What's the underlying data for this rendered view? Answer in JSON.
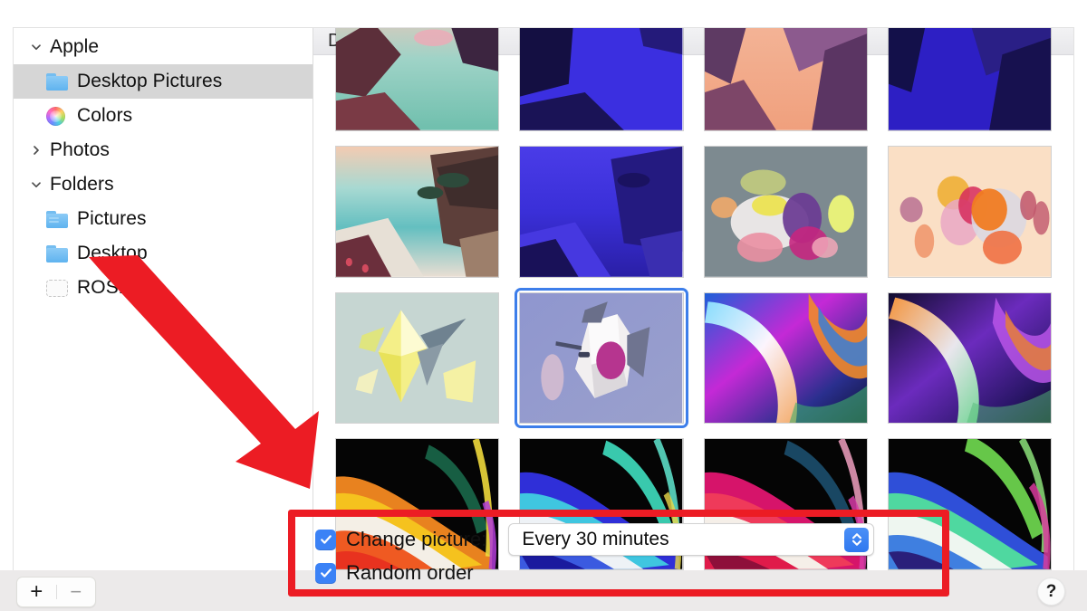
{
  "window": {
    "sidebar": {
      "items": [
        {
          "label": "Apple",
          "icon": "chevron-down-icon",
          "indent": 0,
          "selected": false,
          "kind": "group"
        },
        {
          "label": "Desktop Pictures",
          "icon": "folder-icon",
          "indent": 1,
          "selected": true,
          "kind": "folder"
        },
        {
          "label": "Colors",
          "icon": "color-wheel-icon",
          "indent": 1,
          "selected": false,
          "kind": "wheel"
        },
        {
          "label": "Photos",
          "icon": "chevron-right-icon",
          "indent": 0,
          "selected": false,
          "kind": "group"
        },
        {
          "label": "Folders",
          "icon": "chevron-down-icon",
          "indent": 0,
          "selected": false,
          "kind": "group"
        },
        {
          "label": "Pictures",
          "icon": "folder-lines-icon",
          "indent": 1,
          "selected": false,
          "kind": "folder-lines"
        },
        {
          "label": "Desktop",
          "icon": "folder-icon",
          "indent": 1,
          "selected": false,
          "kind": "folder"
        },
        {
          "label": "ROSE",
          "icon": "folder-dashed-icon",
          "indent": 1,
          "selected": false,
          "kind": "folder-dashed"
        }
      ],
      "add_label": "+",
      "remove_label": "−"
    },
    "panel": {
      "header_title": "Desktop Pictures",
      "thumbnails": [
        {
          "name": "big-sur-day-cropped",
          "selected": false,
          "row": 1
        },
        {
          "name": "big-sur-night-cropped",
          "selected": false,
          "row": 1
        },
        {
          "name": "catalina-dusk-cropped",
          "selected": false,
          "row": 1
        },
        {
          "name": "catalina-night-cropped",
          "selected": false,
          "row": 1
        },
        {
          "name": "big-sur-graphic-day",
          "selected": false,
          "row": 2
        },
        {
          "name": "big-sur-graphic-night",
          "selected": false,
          "row": 2
        },
        {
          "name": "abstract-shapes-gray",
          "selected": false,
          "row": 2
        },
        {
          "name": "abstract-shapes-peach",
          "selected": false,
          "row": 2
        },
        {
          "name": "crystal-yellow",
          "selected": false,
          "row": 3
        },
        {
          "name": "apple-logo-3d",
          "selected": true,
          "row": 3
        },
        {
          "name": "silk-magenta-arc",
          "selected": false,
          "row": 3
        },
        {
          "name": "silk-orange-arc",
          "selected": false,
          "row": 3
        },
        {
          "name": "swirl-orange",
          "selected": false,
          "row": 4
        },
        {
          "name": "swirl-blue",
          "selected": false,
          "row": 4
        },
        {
          "name": "swirl-red",
          "selected": false,
          "row": 4
        },
        {
          "name": "swirl-green",
          "selected": false,
          "row": 4
        }
      ]
    }
  },
  "options": {
    "change_picture_label": "Change picture:",
    "change_picture_checked": true,
    "interval_value": "Every 30 minutes",
    "random_order_label": "Random order",
    "random_order_checked": true
  },
  "footer": {
    "help_label": "?"
  },
  "annotations": {
    "highlight_color": "#ec1c24",
    "arrow_color": "#ec1c24",
    "selection_color": "#3d7eea",
    "checkbox_color": "#3b82f6"
  }
}
